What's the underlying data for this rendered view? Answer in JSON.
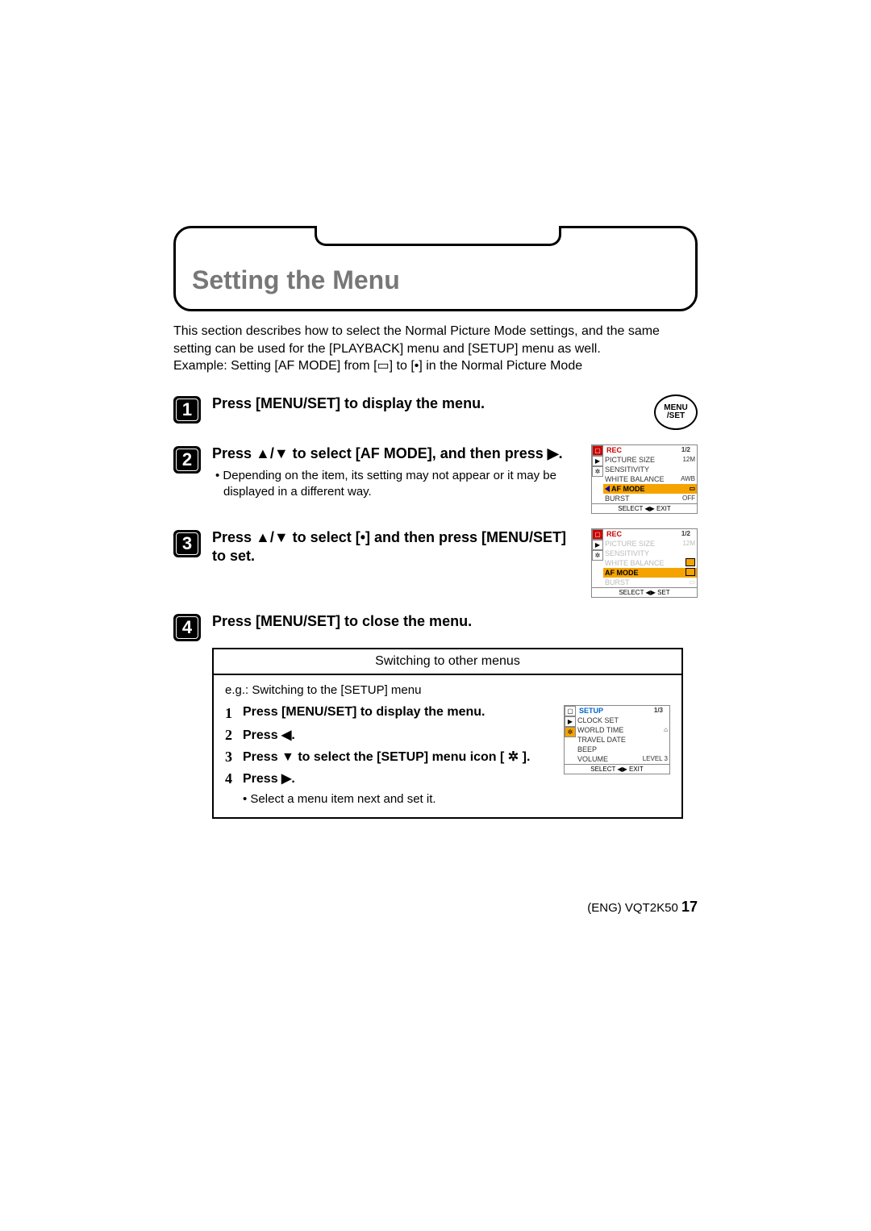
{
  "title": "Setting the Menu",
  "intro_line1": "This section describes how to select the Normal Picture Mode settings, and the same setting can be used for the [PLAYBACK] menu and [SETUP] menu as well.",
  "intro_line2": "Example: Setting [AF MODE] from [▭] to [•] in the Normal Picture Mode",
  "steps": [
    {
      "num": "1",
      "head": "Press [MENU/SET] to display the menu.",
      "button": {
        "top": "MENU",
        "bottom": "/SET"
      }
    },
    {
      "num": "2",
      "head": "Press ▲/▼ to select [AF MODE], and then press ▶.",
      "sub": "• Depending on the item, its setting may not appear or it may be displayed in a different way."
    },
    {
      "num": "3",
      "head": "Press ▲/▼ to select [•] and then press [MENU/SET] to set."
    },
    {
      "num": "4",
      "head": "Press [MENU/SET] to close the menu."
    }
  ],
  "screenA": {
    "header": "REC",
    "pageno": "1/2",
    "rows": [
      {
        "label": "PICTURE SIZE",
        "value": "12M"
      },
      {
        "label": "SENSITIVITY",
        "value": ""
      },
      {
        "label": "WHITE BALANCE",
        "value": "AWB"
      },
      {
        "label": "AF MODE",
        "value": "▭",
        "hl": true
      },
      {
        "label": "BURST",
        "value": "OFF"
      }
    ],
    "footer": "SELECT ◀▶ EXIT"
  },
  "screenB": {
    "header": "REC",
    "pageno": "1/2",
    "rows": [
      {
        "label": "PICTURE SIZE",
        "value": "12M",
        "dim": true
      },
      {
        "label": "SENSITIVITY",
        "value": "",
        "dim": true
      },
      {
        "label": "WHITE BALANCE",
        "value": "",
        "dim": true,
        "valbox": true
      },
      {
        "label": "AF MODE",
        "value": "",
        "hl": true,
        "valbox": true
      },
      {
        "label": "BURST",
        "value": "▭",
        "dim": true
      }
    ],
    "footer": "SELECT ◀▶ SET"
  },
  "switch": {
    "title": "Switching to other menus",
    "eg": "e.g.: Switching to the [SETUP] menu",
    "items": [
      {
        "n": "1",
        "t": "Press [MENU/SET] to display the menu."
      },
      {
        "n": "2",
        "t": "Press ◀."
      },
      {
        "n": "3",
        "t": "Press ▼ to select the [SETUP] menu icon [ ✲ ]."
      },
      {
        "n": "4",
        "t": "Press ▶."
      }
    ],
    "note": "• Select a menu item next and set it."
  },
  "screenC": {
    "header": "SETUP",
    "pageno": "1/3",
    "rows": [
      {
        "label": "CLOCK SET",
        "value": ""
      },
      {
        "label": "WORLD TIME",
        "value": "⌂"
      },
      {
        "label": "TRAVEL DATE",
        "value": ""
      },
      {
        "label": "BEEP",
        "value": ""
      },
      {
        "label": "VOLUME",
        "value": "LEVEL 3"
      }
    ],
    "footer": "SELECT ◀▶ EXIT"
  },
  "footer": {
    "code": "(ENG) VQT2K50",
    "page": "17"
  }
}
